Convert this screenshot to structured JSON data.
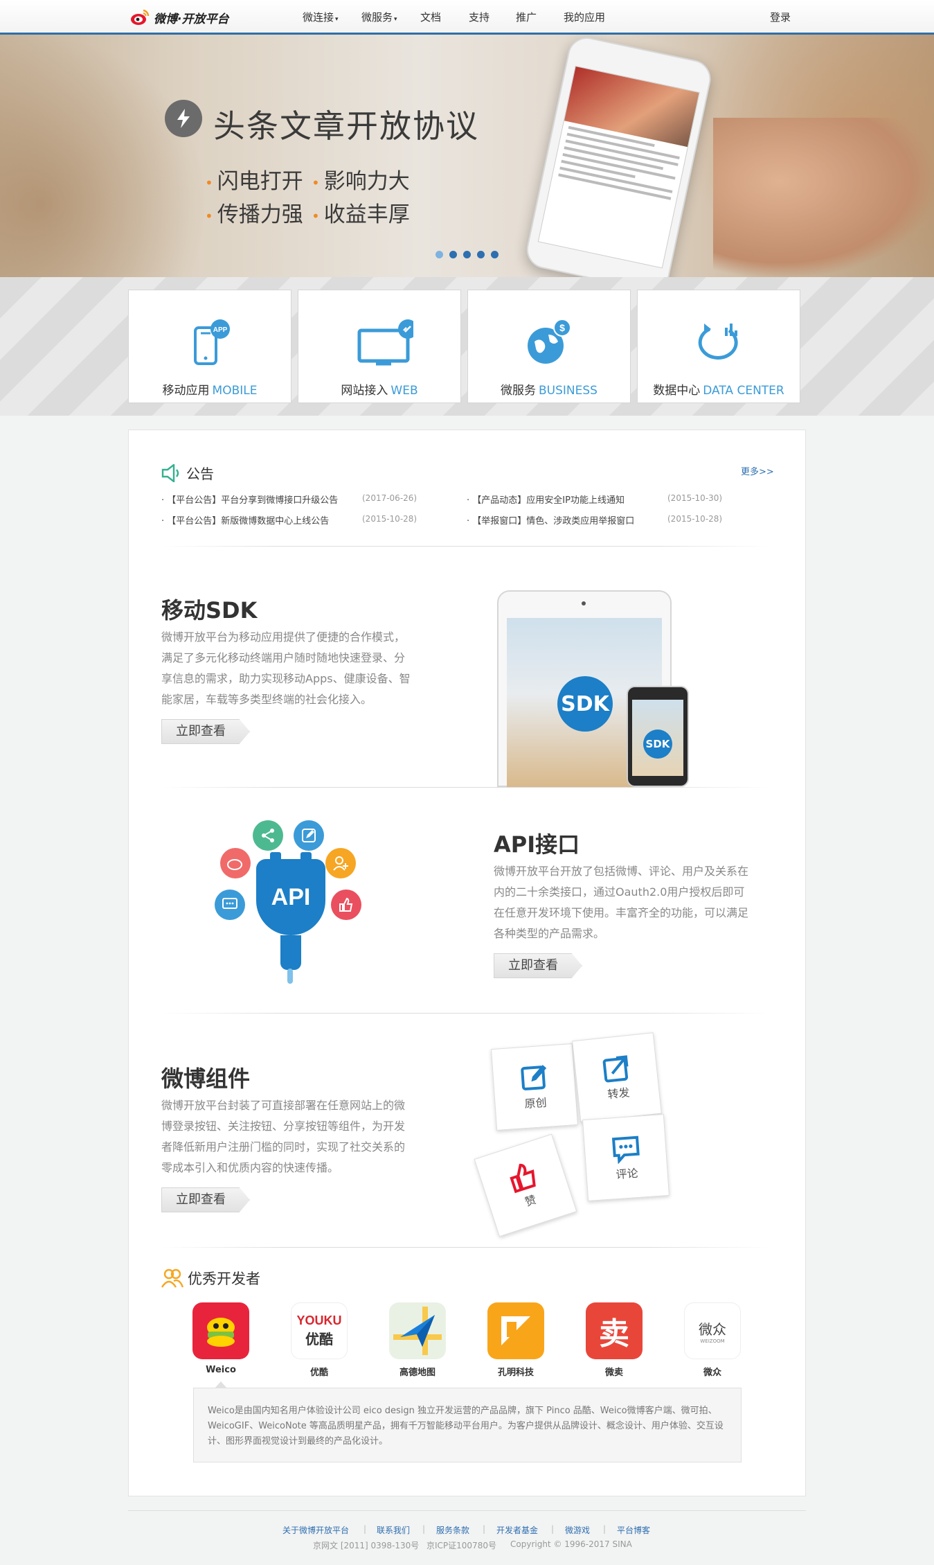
{
  "nav": {
    "logo_text": "微博·开放平台",
    "items": [
      {
        "label": "微连接",
        "dropdown": true
      },
      {
        "label": "微服务",
        "dropdown": true
      },
      {
        "label": "文档",
        "dropdown": false
      },
      {
        "label": "支持",
        "dropdown": false
      },
      {
        "label": "推广",
        "dropdown": false
      },
      {
        "label": "我的应用",
        "dropdown": false
      }
    ],
    "login": "登录",
    "caret": "▾"
  },
  "hero": {
    "title": "头条文章开放协议",
    "features": [
      "闪电打开",
      "影响力大",
      "传播力强",
      "收益丰厚"
    ],
    "bullet": "•",
    "slides": 5,
    "active_slide": 1
  },
  "categories": [
    {
      "cn": "移动应用",
      "en": "MOBILE",
      "icon": "mobile-app-icon"
    },
    {
      "cn": "网站接入",
      "en": "WEB",
      "icon": "monitor-link-icon"
    },
    {
      "cn": "微服务",
      "en": "BUSINESS",
      "icon": "globe-dollar-icon"
    },
    {
      "cn": "数据中心",
      "en": "DATA CENTER",
      "icon": "data-chart-icon"
    }
  ],
  "notice": {
    "title": "公告",
    "more": "更多>>",
    "items": [
      {
        "text": "【平台公告】平台分享到微博接口升级公告",
        "date": "(2017-06-26)"
      },
      {
        "text": "【产品动态】应用安全IP功能上线通知",
        "date": "(2015-10-30)"
      },
      {
        "text": "【平台公告】新版微博数据中心上线公告",
        "date": "(2015-10-28)"
      },
      {
        "text": "【举报窗口】情色、涉政类应用举报窗口",
        "date": "(2015-10-28)"
      }
    ]
  },
  "sdk": {
    "title": "移动SDK",
    "desc": "微博开放平台为移动应用提供了便捷的合作模式，满足了多元化移动终端用户随时随地快速登录、分享信息的需求，助力实现移动Apps、健康设备、智能家居，车载等多类型终端的社会化接入。",
    "button": "立即查看",
    "badge": "SDK"
  },
  "api": {
    "title": "API接口",
    "desc": "微博开放平台开放了包括微博、评论、用户及关系在内的二十余类接口，通过Oauth2.0用户授权后即可在任意开发环境下使用。丰富齐全的功能，可以满足各种类型的产品需求。",
    "button": "立即查看",
    "badge": "API"
  },
  "widgets": {
    "title": "微博组件",
    "desc": "微博开放平台封装了可直接部署在任意网站上的微博登录按钮、关注按钮、分享按钮等组件，为开发者降低新用户注册门槛的同时，实现了社交关系的零成本引入和优质内容的快速传播。",
    "button": "立即查看",
    "tiles": [
      "原创",
      "转发",
      "赞",
      "评论"
    ]
  },
  "developers": {
    "title": "优秀开发者",
    "apps": [
      {
        "name": "Weico",
        "color": "#e8243c"
      },
      {
        "name": "优酷",
        "color": "#ffffff",
        "logo_line1": "YOUKU",
        "logo_line2": "优酷"
      },
      {
        "name": "高德地图",
        "color": "#e9f1e4"
      },
      {
        "name": "孔明科技",
        "color": "#f9a51a"
      },
      {
        "name": "微卖",
        "color": "#e9463a",
        "logo": "卖"
      },
      {
        "name": "微众",
        "color": "#ffffff",
        "logo": "微众",
        "logo_sub": "WEIZOOM"
      }
    ],
    "desc": "Weico是由国内知名用户体验设计公司 eico design 独立开发运营的产品品牌，旗下 Pinco 品酷、Weico微博客户端、微可拍、WeicoGIF、WeicoNote 等高品质明星产品，拥有千万智能移动平台用户。为客户提供从品牌设计、概念设计、用户体验、交互设计、图形界面视觉设计到最终的产品化设计。"
  },
  "footer": {
    "links": [
      "关于微博开放平台",
      "联系我们",
      "服务条款",
      "开发者基金",
      "微游戏",
      "平台博客"
    ],
    "separator": "|",
    "copyright": [
      "京网文 [2011] 0398-130号",
      "京ICP证100780号",
      "Copyright © 1996-2017 SINA"
    ]
  },
  "colors": {
    "accent": "#2e6fb0",
    "link_blue": "#3b9bd8",
    "bullet_orange": "#f08a24"
  }
}
